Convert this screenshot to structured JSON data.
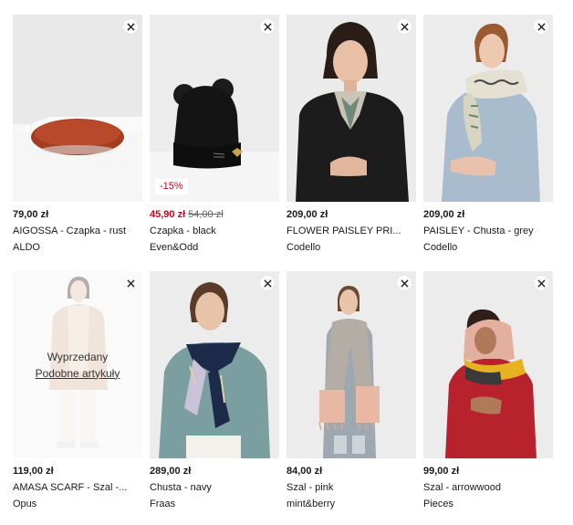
{
  "products": [
    {
      "price": "79,00 zł",
      "name": "AIGOSSA - Czapka - rust",
      "brand": "ALDO"
    },
    {
      "price": "45,90 zł",
      "old_price": "54,00 zł",
      "discount": "-15%",
      "name": "Czapka - black",
      "brand": "Even&Odd"
    },
    {
      "price": "209,00 zł",
      "name": "FLOWER PAISLEY PRI...",
      "brand": "Codello"
    },
    {
      "price": "209,00 zł",
      "name": "PAISLEY - Chusta - grey",
      "brand": "Codello"
    },
    {
      "price": "119,00 zł",
      "name": "AMASA SCARF - Szal -...",
      "brand": "Opus",
      "overlay_title": "Wyprzedany",
      "overlay_link": "Podobne artykuły"
    },
    {
      "price": "289,00 zł",
      "name": "Chusta - navy",
      "brand": "Fraas"
    },
    {
      "price": "84,00 zł",
      "name": "Szal - pink",
      "brand": "mint&berry"
    },
    {
      "price": "99,00 zł",
      "name": "Szal - arrowwood",
      "brand": "Pieces"
    }
  ],
  "colors": {
    "sale": "#d0021b",
    "text": "#1a1a1a",
    "image_bg": "#ececec"
  }
}
